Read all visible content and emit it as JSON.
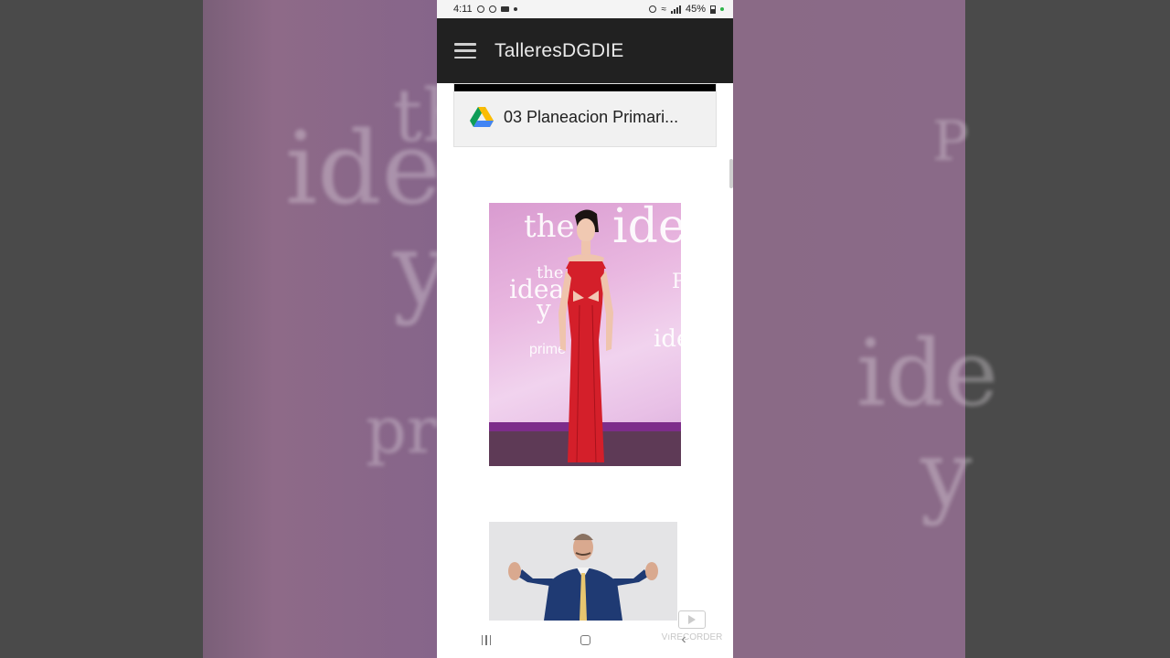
{
  "status_bar": {
    "time": "4:11",
    "battery": "45%"
  },
  "app_bar": {
    "title": "TalleresDGDIE"
  },
  "drive_attachment": {
    "file_name": "03 Planeacion Primari..."
  },
  "photos": [
    {
      "caption_words": [
        "the",
        "idea",
        "the",
        "idea",
        "y",
        "prime",
        "P",
        "ide"
      ]
    },
    {}
  ],
  "background_text": [
    "the",
    "ide",
    "y",
    "pri",
    "P",
    "ide",
    "y"
  ],
  "watermark": {
    "label": "VıRECORDER"
  },
  "colors": {
    "app_bar_bg": "#212121",
    "gown_red": "#d41f2a",
    "suit_navy": "#1f3a73"
  }
}
